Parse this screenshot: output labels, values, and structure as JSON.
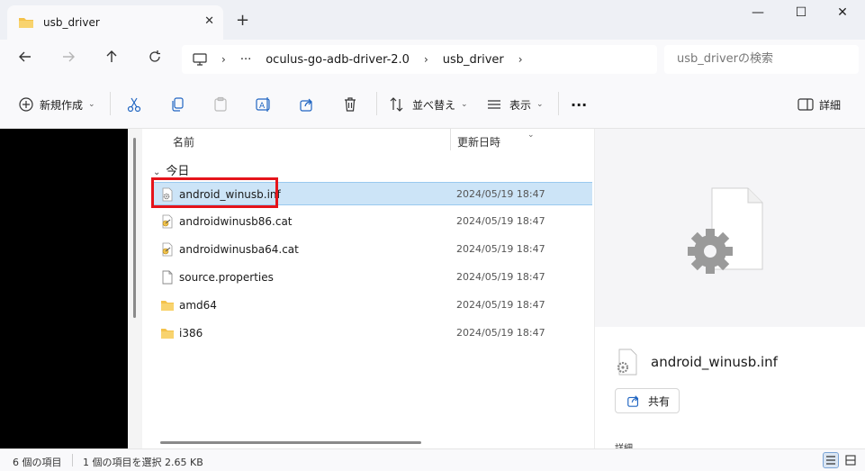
{
  "window": {
    "tab_title": "usb_driver",
    "new_tab": "+",
    "close_tab": "✕",
    "minimize": "—",
    "maximize": "☐",
    "close": "✕"
  },
  "address": {
    "crumbs": [
      "oculus-go-adb-driver-2.0",
      "usb_driver"
    ],
    "more": "···",
    "search_placeholder": "usb_driverの検索"
  },
  "toolbar": {
    "new_label": "新規作成",
    "sort_label": "並べ替え",
    "view_label": "表示",
    "more": "···",
    "details_label": "詳細"
  },
  "list": {
    "col_name": "名前",
    "col_date": "更新日時",
    "group": "今日",
    "files": [
      {
        "name": "android_winusb.inf",
        "date": "2024/05/19 18:47",
        "icon": "inf-settings-icon",
        "selected": true
      },
      {
        "name": "androidwinusb86.cat",
        "date": "2024/05/19 18:47",
        "icon": "catalog-file-icon",
        "selected": false
      },
      {
        "name": "androidwinusba64.cat",
        "date": "2024/05/19 18:47",
        "icon": "catalog-file-icon",
        "selected": false
      },
      {
        "name": "source.properties",
        "date": "2024/05/19 18:47",
        "icon": "blank-file-icon",
        "selected": false
      },
      {
        "name": "amd64",
        "date": "2024/05/19 18:47",
        "icon": "folder-icon",
        "selected": false
      },
      {
        "name": "i386",
        "date": "2024/05/19 18:47",
        "icon": "folder-icon",
        "selected": false
      }
    ]
  },
  "preview": {
    "filename": "android_winusb.inf",
    "share_label": "共有",
    "details_heading": "詳細"
  },
  "status": {
    "item_count": "6 個の項目",
    "selection": "1 個の項目を選択  2.65 KB"
  },
  "colors": {
    "selection": "#cce4f7",
    "highlight_box": "#e5141b",
    "folder": "#f4c24a"
  }
}
